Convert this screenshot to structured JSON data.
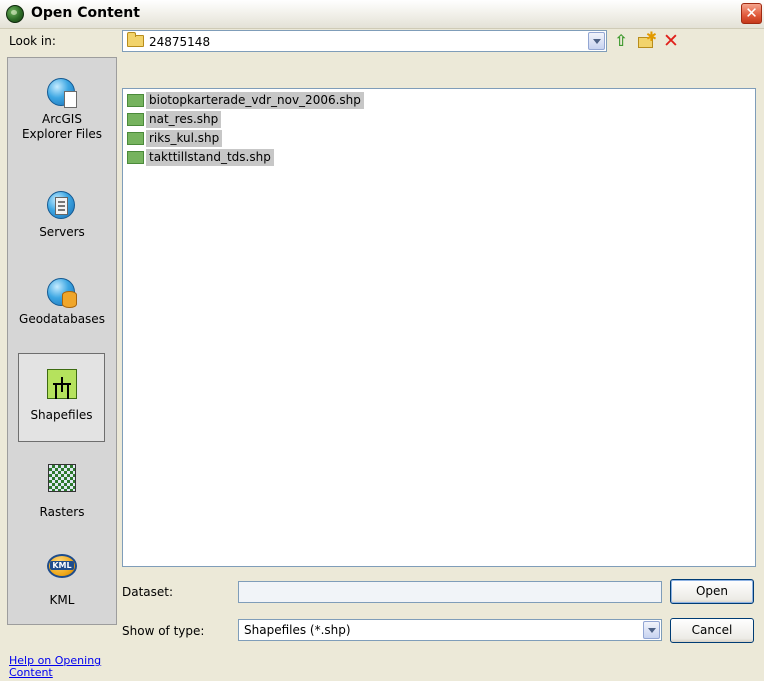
{
  "window": {
    "title": "Open Content",
    "close_glyph": "✕"
  },
  "look_in": {
    "label": "Look in:",
    "value": "24875148"
  },
  "toolbar": {
    "up_icon": "up-one-level-icon",
    "new_folder_icon": "new-folder-icon",
    "delete_icon": "delete-icon"
  },
  "places": [
    {
      "label": "ArcGIS\nExplorer Files",
      "icon": "globe-document-icon"
    },
    {
      "label": "Servers",
      "icon": "server-globe-icon"
    },
    {
      "label": "Geodatabases",
      "icon": "geodatabase-icon"
    },
    {
      "label": "Shapefiles",
      "icon": "shapefile-icon",
      "selected": true
    },
    {
      "label": "Rasters",
      "icon": "raster-icon"
    },
    {
      "label": "KML",
      "icon": "kml-icon"
    }
  ],
  "files": [
    {
      "name": "biotopkarterade_vdr_nov_2006.shp"
    },
    {
      "name": "nat_res.shp"
    },
    {
      "name": "riks_kul.shp"
    },
    {
      "name": "takttillstand_tds.shp"
    }
  ],
  "dataset": {
    "label": "Dataset:",
    "value": ""
  },
  "show_type": {
    "label": "Show of type:",
    "value": "Shapefiles (*.shp)"
  },
  "buttons": {
    "open": "Open",
    "cancel": "Cancel"
  },
  "help_link": "Help on Opening Content",
  "colors": {
    "selection_gray": "#c7c7c7",
    "dialog_bg": "#ece9d8",
    "close_red": "#e0593a"
  }
}
